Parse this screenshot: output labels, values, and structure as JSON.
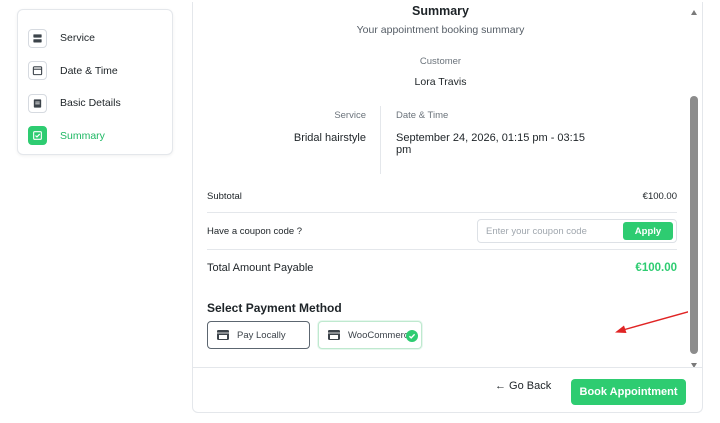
{
  "sidebar": {
    "items": [
      {
        "label": "Service",
        "icon": "server-icon",
        "active": false
      },
      {
        "label": "Date & Time",
        "icon": "calendar-icon",
        "active": false
      },
      {
        "label": "Basic Details",
        "icon": "document-icon",
        "active": false
      },
      {
        "label": "Summary",
        "icon": "checkbox-icon",
        "active": true
      }
    ]
  },
  "summary": {
    "title": "Summary",
    "subtitle": "Your appointment booking summary",
    "customer_label": "Customer",
    "customer_name": "Lora Travis",
    "service_label": "Service",
    "service_value": "Bridal hairstyle",
    "datetime_label": "Date & Time",
    "datetime_value": "September 24, 2026, 01:15 pm - 03:15 pm",
    "subtotal_label": "Subtotal",
    "subtotal_value": "€100.00",
    "coupon_label": "Have a coupon code ?",
    "coupon_placeholder": "Enter your coupon code",
    "coupon_value": "",
    "apply_label": "Apply",
    "total_label": "Total Amount Payable",
    "total_value": "€100.00"
  },
  "payment": {
    "title": "Select Payment Method",
    "options": [
      {
        "label": "Pay Locally",
        "icon": "store-icon",
        "selected": false
      },
      {
        "label": "WooCommerce",
        "icon": "store-icon",
        "selected": true
      }
    ]
  },
  "footer": {
    "back_label": "← Go Back",
    "book_label": "Book Appointment"
  },
  "colors": {
    "accent": "#2ecc71",
    "annotation": "#e02424"
  }
}
